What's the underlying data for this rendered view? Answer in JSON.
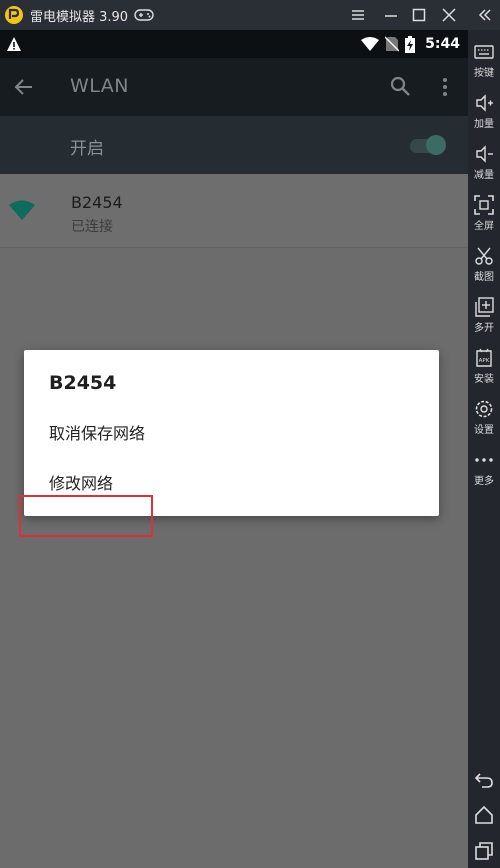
{
  "emulator": {
    "title": "雷电模拟器 3.90",
    "toolbar": [
      {
        "label": "按键",
        "icon": "keyboard-icon"
      },
      {
        "label": "加量",
        "icon": "volume-up-icon"
      },
      {
        "label": "减量",
        "icon": "volume-down-icon"
      },
      {
        "label": "全屏",
        "icon": "fullscreen-icon"
      },
      {
        "label": "截图",
        "icon": "scissors-icon"
      },
      {
        "label": "多开",
        "icon": "multi-instance-icon"
      },
      {
        "label": "安装",
        "icon": "apk-install-icon"
      },
      {
        "label": "设置",
        "icon": "gear-icon"
      },
      {
        "label": "更多",
        "icon": "more-dots-icon"
      }
    ]
  },
  "statusbar": {
    "time": "5:44"
  },
  "appbar": {
    "title": "WLAN"
  },
  "switch": {
    "label": "开启",
    "on": true
  },
  "network": {
    "ssid": "B2454",
    "status": "已连接"
  },
  "dialog": {
    "title": "B2454",
    "options": [
      "取消保存网络",
      "修改网络"
    ]
  },
  "colors": {
    "accent": "#3c6b66",
    "wifi": "#0f6b5c",
    "highlight": "#d8333a",
    "dim": "#6c6c6c"
  }
}
